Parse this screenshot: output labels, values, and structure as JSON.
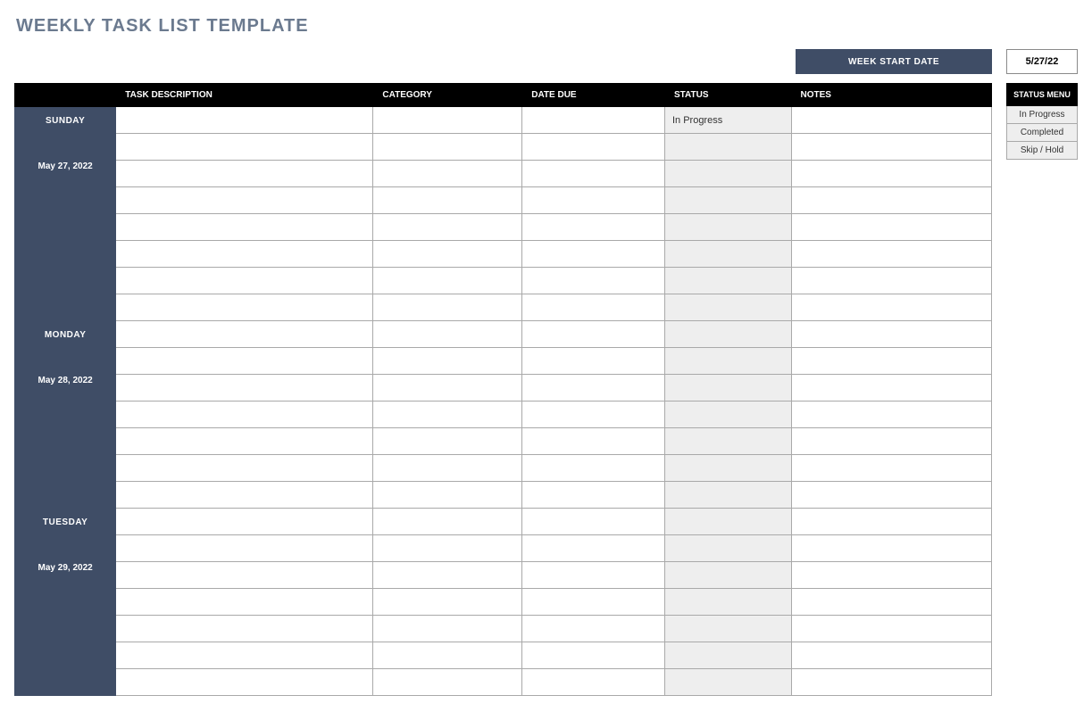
{
  "title": "WEEKLY TASK LIST TEMPLATE",
  "week_start_date": {
    "label": "WEEK START DATE",
    "value": "5/27/22"
  },
  "columns": {
    "task": "TASK DESCRIPTION",
    "category": "CATEGORY",
    "due": "DATE DUE",
    "status": "STATUS",
    "notes": "NOTES"
  },
  "days": [
    {
      "name": "SUNDAY",
      "date": "May 27, 2022",
      "rows": [
        {
          "task": "",
          "category": "",
          "due": "",
          "status": "In Progress",
          "notes": ""
        },
        {
          "task": "",
          "category": "",
          "due": "",
          "status": "",
          "notes": ""
        },
        {
          "task": "",
          "category": "",
          "due": "",
          "status": "",
          "notes": ""
        },
        {
          "task": "",
          "category": "",
          "due": "",
          "status": "",
          "notes": ""
        },
        {
          "task": "",
          "category": "",
          "due": "",
          "status": "",
          "notes": ""
        },
        {
          "task": "",
          "category": "",
          "due": "",
          "status": "",
          "notes": ""
        },
        {
          "task": "",
          "category": "",
          "due": "",
          "status": "",
          "notes": ""
        },
        {
          "task": "",
          "category": "",
          "due": "",
          "status": "",
          "notes": ""
        }
      ]
    },
    {
      "name": "MONDAY",
      "date": "May 28, 2022",
      "rows": [
        {
          "task": "",
          "category": "",
          "due": "",
          "status": "",
          "notes": ""
        },
        {
          "task": "",
          "category": "",
          "due": "",
          "status": "",
          "notes": ""
        },
        {
          "task": "",
          "category": "",
          "due": "",
          "status": "",
          "notes": ""
        },
        {
          "task": "",
          "category": "",
          "due": "",
          "status": "",
          "notes": ""
        },
        {
          "task": "",
          "category": "",
          "due": "",
          "status": "",
          "notes": ""
        },
        {
          "task": "",
          "category": "",
          "due": "",
          "status": "",
          "notes": ""
        },
        {
          "task": "",
          "category": "",
          "due": "",
          "status": "",
          "notes": ""
        }
      ]
    },
    {
      "name": "TUESDAY",
      "date": "May 29, 2022",
      "rows": [
        {
          "task": "",
          "category": "",
          "due": "",
          "status": "",
          "notes": ""
        },
        {
          "task": "",
          "category": "",
          "due": "",
          "status": "",
          "notes": ""
        },
        {
          "task": "",
          "category": "",
          "due": "",
          "status": "",
          "notes": ""
        },
        {
          "task": "",
          "category": "",
          "due": "",
          "status": "",
          "notes": ""
        },
        {
          "task": "",
          "category": "",
          "due": "",
          "status": "",
          "notes": ""
        },
        {
          "task": "",
          "category": "",
          "due": "",
          "status": "",
          "notes": ""
        },
        {
          "task": "",
          "category": "",
          "due": "",
          "status": "",
          "notes": ""
        }
      ]
    }
  ],
  "status_menu": {
    "header": "STATUS MENU",
    "items": [
      "In Progress",
      "Completed",
      "Skip / Hold"
    ]
  }
}
